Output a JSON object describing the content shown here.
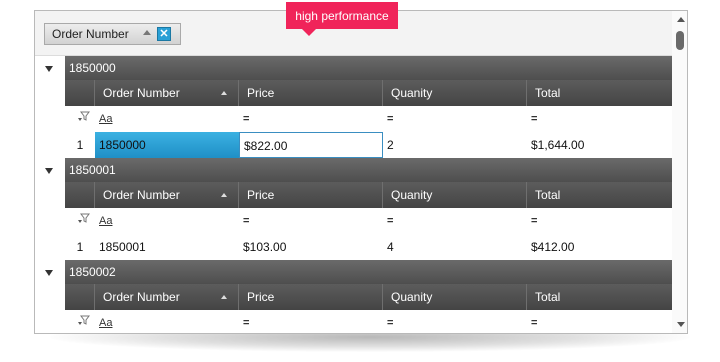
{
  "callout": {
    "text": "high performance"
  },
  "group_panel": {
    "chip_label": "Order Number",
    "close_glyph": "✕"
  },
  "columns": [
    "Order Number",
    "Price",
    "Quanity",
    "Total"
  ],
  "filter_row": {
    "text_filter": "Aa",
    "eq": "="
  },
  "groups": [
    {
      "key": "1850000",
      "row": {
        "num": "1",
        "order": "1850000",
        "price": "$822.00",
        "qty": "2",
        "total": "$1,644.00"
      }
    },
    {
      "key": "1850001",
      "row": {
        "num": "1",
        "order": "1850001",
        "price": "$103.00",
        "qty": "4",
        "total": "$412.00"
      }
    },
    {
      "key": "1850002"
    }
  ],
  "icons": {
    "group_expand": "triangle-down-icon",
    "sort": "sort-ascending-icon",
    "filter": "filter-icon",
    "scroll_up": "arrow-up-icon",
    "scroll_down": "arrow-down-icon"
  },
  "colors": {
    "accent": "#f0245a",
    "selection": "#2aa0d6",
    "header_dark": "#4e4e4e"
  }
}
